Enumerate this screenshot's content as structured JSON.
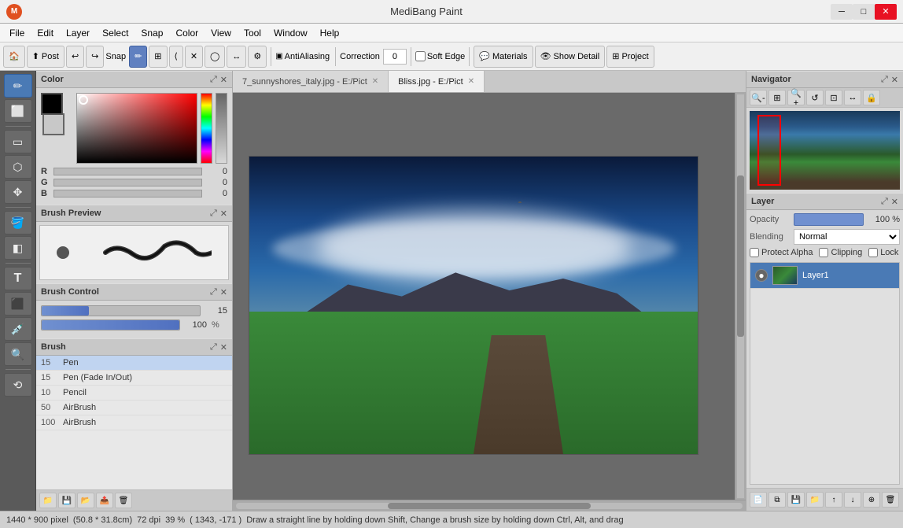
{
  "app": {
    "title": "MediBang Paint",
    "icon": "M"
  },
  "window_controls": {
    "minimize": "─",
    "maximize": "□",
    "close": "✕"
  },
  "menu": {
    "items": [
      "File",
      "Edit",
      "Layer",
      "Select",
      "Snap",
      "Color",
      "View",
      "Tool",
      "Window",
      "Help"
    ]
  },
  "toolbar": {
    "post_label": "Post",
    "snap_label": "Snap",
    "antialias_label": "AntiAliasing",
    "correction_label": "Correction",
    "correction_value": "0",
    "soft_edge_label": "Soft Edge",
    "materials_label": "Materials",
    "show_detail_label": "Show Detail",
    "project_label": "Project"
  },
  "tabs": [
    {
      "label": "7_sunnyshores_italy.jpg - E:/Pict",
      "active": false
    },
    {
      "label": "Bliss.jpg - E:/Pict",
      "active": true
    }
  ],
  "color_panel": {
    "title": "Color",
    "r_value": "0",
    "g_value": "0",
    "b_value": "0",
    "r_label": "R",
    "g_label": "G",
    "b_label": "B"
  },
  "brush_preview_panel": {
    "title": "Brush Preview"
  },
  "brush_control_panel": {
    "title": "Brush Control",
    "size_value": "15",
    "opacity_value": "100",
    "opacity_unit": "%"
  },
  "brush_panel": {
    "title": "Brush",
    "items": [
      {
        "num": "15",
        "name": "Pen",
        "active": true
      },
      {
        "num": "15",
        "name": "Pen (Fade In/Out)",
        "active": false
      },
      {
        "num": "10",
        "name": "Pencil",
        "active": false
      },
      {
        "num": "50",
        "name": "AirBrush",
        "active": false
      },
      {
        "num": "100",
        "name": "AirBrush",
        "active": false
      }
    ]
  },
  "navigator": {
    "title": "Navigator",
    "buttons": [
      "🔍-",
      "⊞",
      "🔍+",
      "↺",
      "⊡",
      "↔",
      "🔒"
    ]
  },
  "layer_panel": {
    "title": "Layer",
    "opacity_label": "Opacity",
    "opacity_value": "100 %",
    "blending_label": "Blending",
    "blending_value": "Normal",
    "protect_alpha_label": "Protect Alpha",
    "clipping_label": "Clipping",
    "lock_label": "Lock",
    "layers": [
      {
        "name": "Layer1",
        "visible": true,
        "active": true
      }
    ]
  },
  "status_bar": {
    "dimensions": "1440 * 900 pixel",
    "size_cm": "(50.8 * 31.8cm)",
    "dpi": "72 dpi",
    "zoom": "39 %",
    "coords": "( 1343, -171 )",
    "hint": "Draw a straight line by holding down Shift, Change a brush size by holding down Ctrl, Alt, and drag"
  }
}
